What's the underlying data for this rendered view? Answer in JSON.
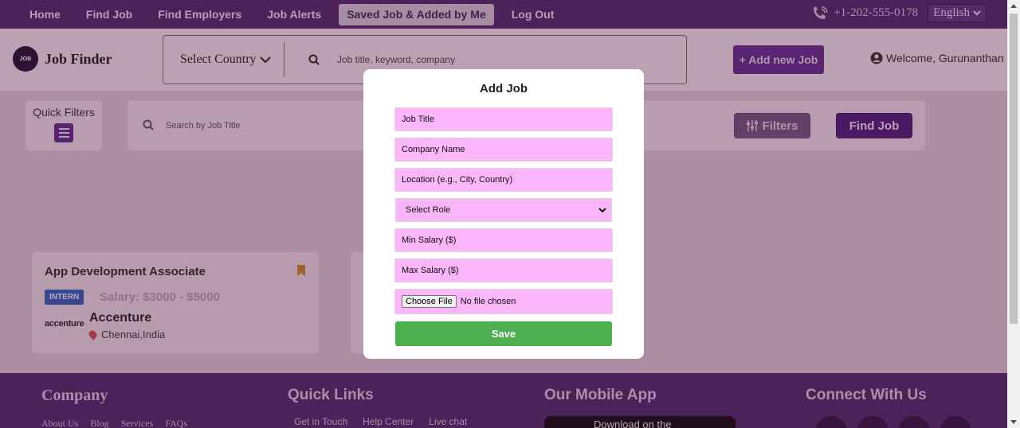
{
  "nav": {
    "links": [
      "Home",
      "Find Job",
      "Find Employers",
      "Job Alerts",
      "Saved Job & Added by Me",
      "Log Out"
    ],
    "phone": "+1-202-555-0178",
    "language": "English"
  },
  "header": {
    "logo_badge": "JOB",
    "logo_text": "Job Finder",
    "country_select": "Select Country",
    "keyword_placeholder": "Job title, keyword, company",
    "add_job": "+ Add new Job",
    "welcome": "Welcome, Gurunanthan"
  },
  "filters": {
    "quick_filters": "Quick Filters",
    "search_placeholder": "Search by Job Title",
    "filters_button": "Filters",
    "find_job_button": "Find Job"
  },
  "cards": [
    {
      "title": "App Development Associate",
      "badge": "INTERN",
      "salary": "Salary: $3000 - $5000",
      "company_logo": "accenture",
      "company": "Accenture",
      "location": "Chennai,India"
    }
  ],
  "footer": {
    "company_heading": "Company",
    "company_links": [
      "About Us",
      "Blog",
      "Services",
      "FAQs"
    ],
    "quick_links_heading": "Quick Links",
    "quick_links": [
      "Get in Touch",
      "Help Center",
      "Live chat"
    ],
    "mobile_app_heading": "Our Mobile App",
    "app_store_text": "Download on the",
    "connect_heading": "Connect With Us"
  },
  "modal": {
    "title": "Add Job",
    "job_title_placeholder": "Job Title",
    "company_placeholder": "Company Name",
    "location_placeholder": "Location (e.g., City, Country)",
    "role_select": "Select Role",
    "min_salary_placeholder": "Min Salary ($)",
    "max_salary_placeholder": "Max Salary ($)",
    "file_button": "Choose File",
    "file_status": "No file chosen",
    "save": "Save"
  },
  "colors": {
    "nav_bg": "#4a2a6b",
    "field_bg": "#fbb6fb",
    "save_bg": "#4caf50",
    "accent": "#5e2f8e"
  }
}
